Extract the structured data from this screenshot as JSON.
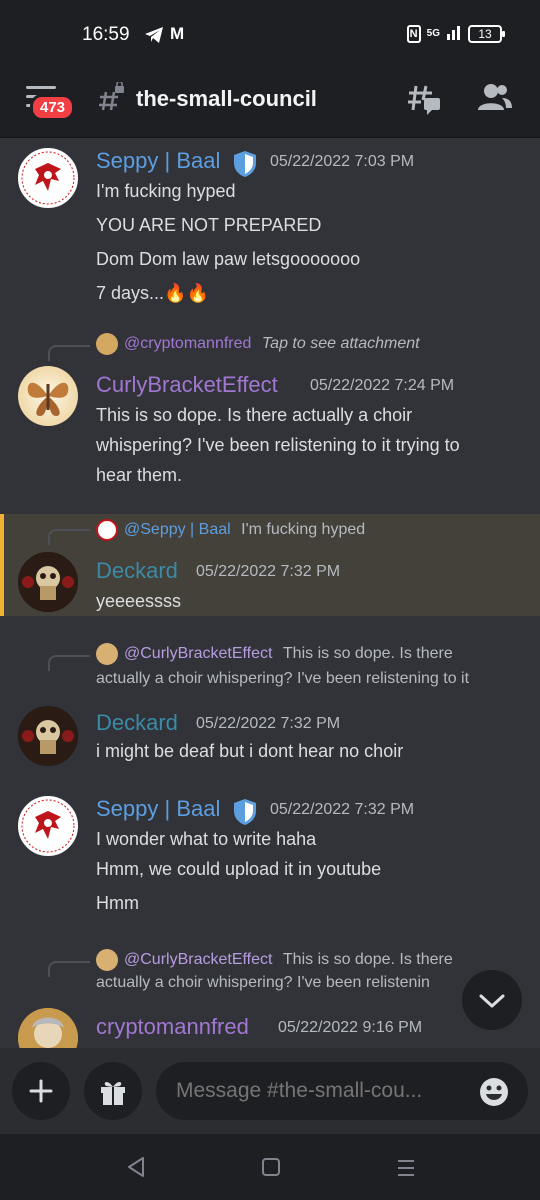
{
  "status": {
    "time": "16:59",
    "nfc": "N",
    "network": "5G",
    "battery": "13"
  },
  "header": {
    "badge": "473",
    "channel": "the-small-council"
  },
  "messages": [
    {
      "author": "Seppy | Baal",
      "timestamp": "05/22/2022 7:03 PM",
      "lines": [
        "I'm fucking hyped",
        "YOU ARE NOT PREPARED",
        "Dom Dom law paw letsgooooooo",
        "7 days...🔥🔥"
      ]
    },
    {
      "reply_to": "@cryptomannfred",
      "reply_text": "Tap to see attachment",
      "author": "CurlyBracketEffect",
      "timestamp": "05/22/2022 7:24 PM",
      "lines": [
        "This is so dope. Is there actually a choir",
        "whispering? I've been relistening to it trying to",
        "hear them."
      ]
    },
    {
      "reply_to": "@Seppy | Baal",
      "reply_text": "I'm fucking hyped",
      "author": "Deckard",
      "timestamp": "05/22/2022 7:32 PM",
      "lines": [
        "yeeeessss"
      ]
    },
    {
      "reply_to": "@CurlyBracketEffect",
      "reply_text": "This is so dope. Is there",
      "reply_text_2": "actually a choir whispering? I've been relistening to it",
      "author": "Deckard",
      "timestamp": "05/22/2022 7:32 PM",
      "lines": [
        "i might be deaf but i dont hear no choir"
      ]
    },
    {
      "author": "Seppy | Baal",
      "timestamp": "05/22/2022 7:32 PM",
      "lines": [
        "I wonder what to write haha",
        "Hmm, we could upload it in youtube",
        "Hmm"
      ]
    },
    {
      "reply_to": "@CurlyBracketEffect",
      "reply_text": "This is so dope. Is there",
      "reply_text_2": "actually a choir whispering? I've been relistenin",
      "author": "cryptomannfred",
      "timestamp": "05/22/2022 9:16 PM"
    }
  ],
  "composer": {
    "placeholder": "Message #the-small-cou..."
  },
  "colors": {
    "seppy": "#5d9ee0",
    "curly": "#a277d2",
    "deckard": "#3b8aa6",
    "crypto": "#a277d2",
    "highlight_border": "#f0b232"
  }
}
